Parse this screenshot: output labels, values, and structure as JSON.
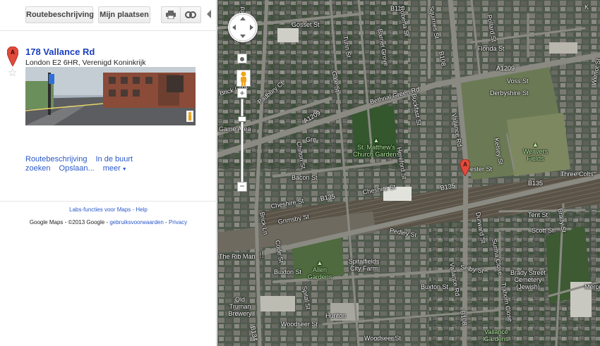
{
  "toolbar": {
    "route_label": "Routebeschrijving",
    "places_label": "Mijn plaatsen",
    "print_icon": "print-icon",
    "link_icon": "link-icon"
  },
  "result": {
    "marker_letter": "A",
    "name": "178 Vallance Rd",
    "address": "London E2 6HR, Verenigd Koninkrijk",
    "actions": {
      "route": "Routebeschrijving",
      "nearby": "In de buurt",
      "search": "zoeken",
      "save": "Opslaan...",
      "more": "meer"
    }
  },
  "footer": {
    "labs": "Labs-functies voor Maps",
    "sep": " - ",
    "help": "Help",
    "copyright": "Google Maps - ©2013 Google - ",
    "terms": "gebruiksvoorwaarden",
    "sep2": " - ",
    "privacy": "Privacy"
  },
  "map": {
    "marker_letter": "A",
    "roads": {
      "gosset": "Gosset St",
      "b118": "B118",
      "roberta": "Roberta St",
      "squirries": "Squirries St",
      "pollard": "Pollard St",
      "florida": "Florida St",
      "columbia": "Columbia Rd",
      "turin": "Turin St",
      "barnet": "Barnet Grove",
      "b108a": "B108",
      "a1209a": "A1209",
      "a1209b": "A1209",
      "voss": "Voss St",
      "derbyshire": "Derbyshire St",
      "bethnal": "Bethnal Green Rd",
      "padbury": "Padbury Ct",
      "brick": "Brick Lane",
      "game": "Game Area",
      "gales": "Gale St",
      "buckfast": "Buckfast St",
      "vallance1": "Vallance Rd",
      "wilmot": "Wilmot St",
      "kelsey": "Kelsey St",
      "weavers": "Weavers Fields",
      "stmatthew": "St. Matthew's Church Gardens",
      "hereford": "Hereford St",
      "chilton": "Chilton St",
      "gre": "Gre",
      "bacon": "Bacon St",
      "cheshire1": "Cheshire St",
      "cheshire2": "Cheshire St",
      "b135a": "B135",
      "b135b": "B135",
      "b135c": "B135",
      "threecolts": "Three Colts",
      "chester": "ester St",
      "grimsby": "Grimsby St",
      "tent": "Tent St",
      "scott": "Scott St",
      "pedley": "Pedley St",
      "brady": "Brady St",
      "bricklane2": "Brick Ln",
      "code": "Code St",
      "ribman": "The Rib Man",
      "allen": "Allen Gardens",
      "spitalfields": "Spitalfields City Farm",
      "durward": "Durward St",
      "selby": "Selby St",
      "buxton1": "Buxton St",
      "buxton2": "Buxton St",
      "surma": "Surma Close",
      "bradycem": "Brady Street Cemetery (Jewish)",
      "mercer": "Merce",
      "vallance2": "Vallance Rd",
      "b108b": "B108",
      "trahorn": "Trahorn Close",
      "oldtruman": "Old Truman Brewery",
      "spital": "Spital St",
      "hunton": "Hunton",
      "b134": "B134",
      "woodseer1": "Woodseer St",
      "woodseer2": "Woodseer St",
      "vallancegdn": "Vallance Gardens",
      "kirkst": "K"
    }
  }
}
